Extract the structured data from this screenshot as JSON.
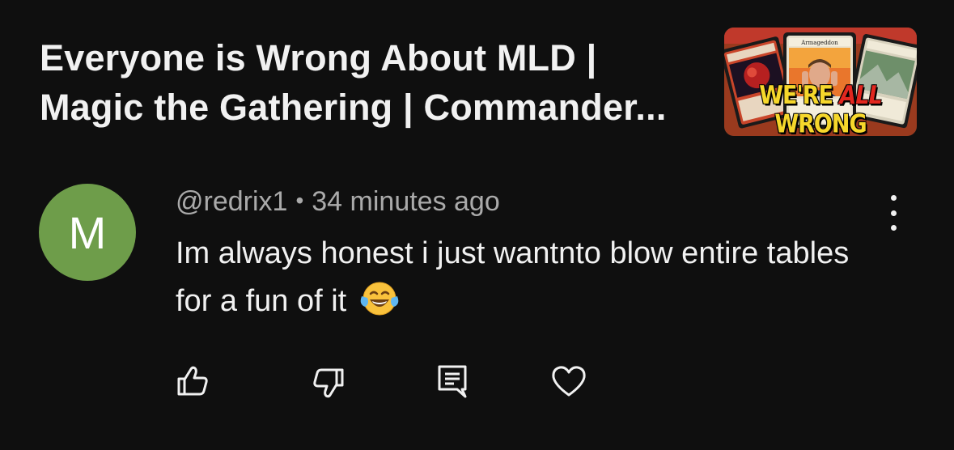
{
  "video": {
    "title_line1": "Everyone is Wrong About MLD |",
    "title_line2": "Magic the Gathering | Commander...",
    "thumbnail": {
      "caption_part1": "WE'RE ",
      "caption_highlight": "ALL",
      "caption_part2": " WRONG",
      "card_title": "Armageddon",
      "colors": {
        "caption": "#f6d72b",
        "highlight": "#e2271f"
      }
    }
  },
  "comment": {
    "avatar_letter": "M",
    "avatar_color": "#6e9d4a",
    "author": "@redrix1",
    "separator": "•",
    "timestamp": "34 minutes ago",
    "text": "Im always honest i just wantnto blow entire tables for a fun of it",
    "emoji": "face-with-tears-of-joy"
  },
  "actions": {
    "icons": [
      "thumbs-up-icon",
      "thumbs-down-icon",
      "reply-icon",
      "heart-icon"
    ]
  },
  "menu_icon": "more-vertical-icon"
}
